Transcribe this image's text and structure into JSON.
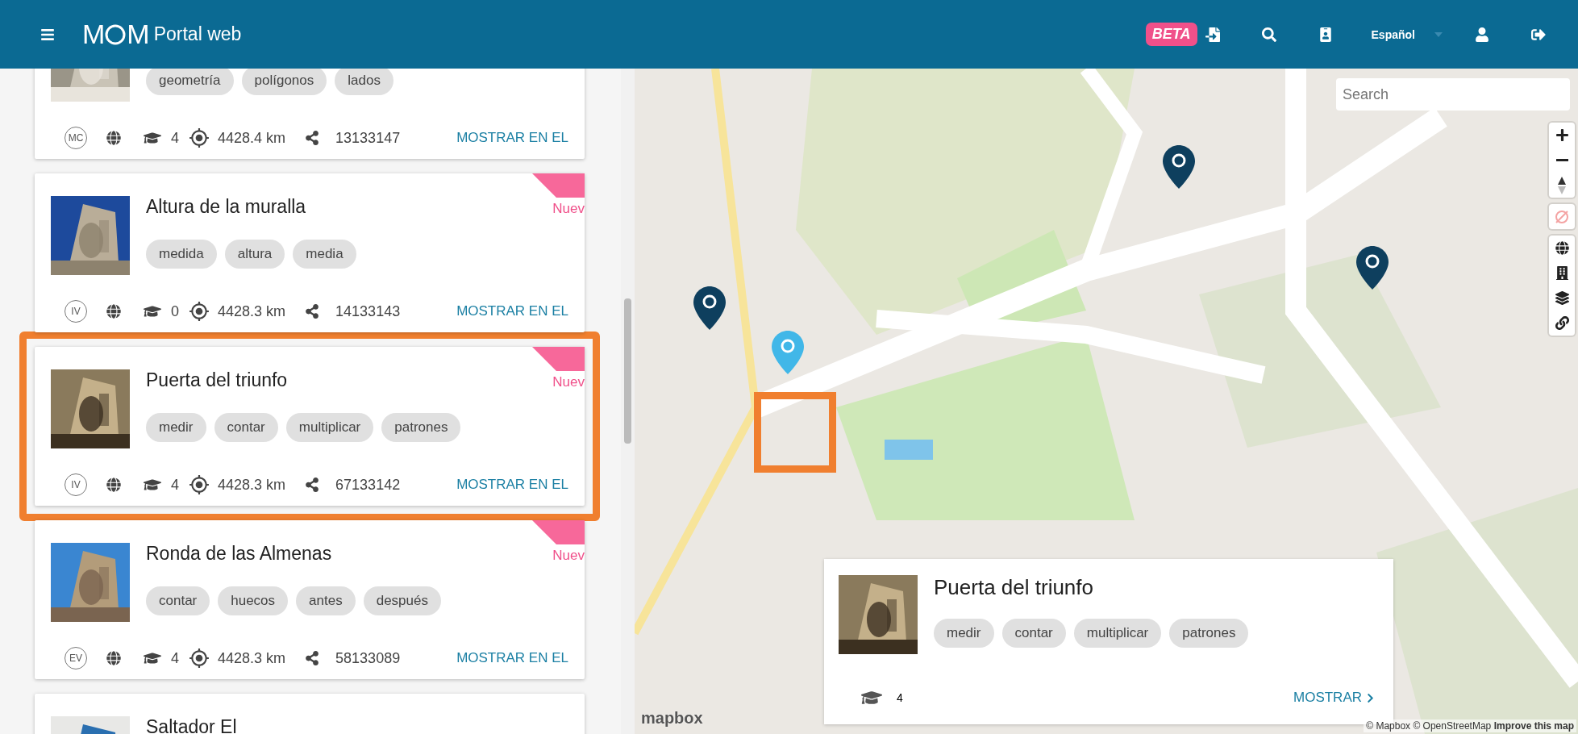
{
  "header": {
    "logo": {
      "left": "M",
      "right": "M"
    },
    "title": "Portal web",
    "beta": "BETA",
    "language": "Español"
  },
  "cards": [
    {
      "tags": [
        "geometría",
        "polígonos",
        "lados"
      ],
      "level": "MC",
      "students": "4",
      "distance": "4428.4 km",
      "code": "13133147",
      "link": "MOSTRAR EN EL",
      "highlighted": false
    },
    {
      "title": "Altura de la muralla",
      "tags": [
        "medida",
        "altura",
        "media"
      ],
      "level": "IV",
      "students": "0",
      "distance": "4428.3 km",
      "code": "14133143",
      "link": "MOSTRAR EN EL",
      "badge": "Nuev",
      "highlighted": false
    },
    {
      "title": "Puerta del triunfo",
      "tags": [
        "medir",
        "contar",
        "multiplicar",
        "patrones"
      ],
      "level": "IV",
      "students": "4",
      "distance": "4428.3 km",
      "code": "67133142",
      "link": "MOSTRAR EN EL",
      "badge": "Nuev",
      "highlighted": true
    },
    {
      "title": "Ronda de las Almenas",
      "tags": [
        "contar",
        "huecos",
        "antes",
        "después"
      ],
      "level": "EV",
      "students": "4",
      "distance": "4428.3 km",
      "code": "58133089",
      "link": "MOSTRAR EN EL",
      "badge": "Nuev",
      "highlighted": false
    },
    {
      "title": "Saltador El",
      "highlighted": false
    }
  ],
  "map": {
    "search": {
      "placeholder": "Search"
    },
    "markers": [
      {
        "selected": false
      },
      {
        "selected": false
      },
      {
        "selected": true
      },
      {
        "selected": false
      }
    ],
    "popup": {
      "title": "Puerta del triunfo",
      "tags": [
        "medir",
        "contar",
        "multiplicar",
        "patrones"
      ],
      "students": "4",
      "link": "MOSTRAR"
    },
    "logo": "mapbox",
    "attribution": "© Mapbox © OpenStreetMap",
    "improve": "Improve this map"
  }
}
